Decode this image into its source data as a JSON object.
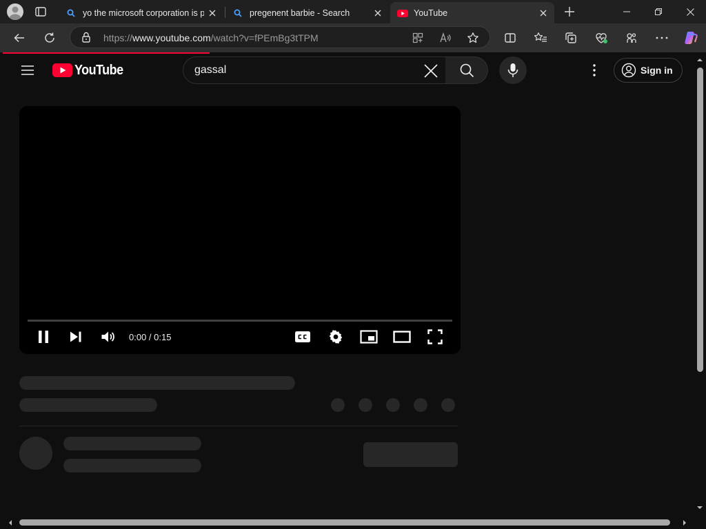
{
  "browser": {
    "tabs": [
      {
        "title": "yo the microsoft corporation is pr",
        "icon": "search-icon",
        "active": false
      },
      {
        "title": "pregenent barbie - Search",
        "icon": "search-icon",
        "active": false
      },
      {
        "title": "YouTube",
        "icon": "youtube-icon",
        "active": true
      }
    ],
    "address": {
      "scheme": "https://",
      "host": "www.youtube.com",
      "path": "/watch?v=fPEmBg3tTPM"
    }
  },
  "youtube": {
    "logo_text": "YouTube",
    "search_value": "gassal",
    "sign_in_label": "Sign in",
    "player": {
      "time": "0:00 / 0:15",
      "progress": 0
    }
  },
  "colors": {
    "brand_red": "#ff0033",
    "background": "#0f0f0f",
    "skeleton": "#272727"
  }
}
